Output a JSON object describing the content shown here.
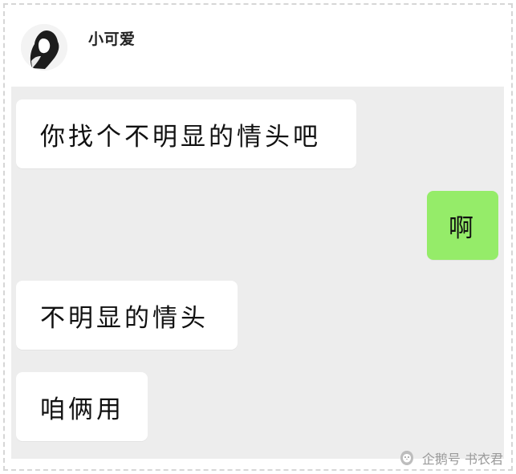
{
  "contact": {
    "name": "小可爱"
  },
  "messages": [
    {
      "side": "left",
      "text": "你找个不明显的情头吧"
    },
    {
      "side": "right",
      "text": "啊"
    },
    {
      "side": "left",
      "text": "不明显的情头"
    },
    {
      "side": "left",
      "text": "咱俩用"
    }
  ],
  "watermark": {
    "text": "企鹅号 书衣君"
  },
  "colors": {
    "chat_bg": "#ededed",
    "incoming_bubble": "#ffffff",
    "outgoing_bubble": "#95ec69"
  }
}
